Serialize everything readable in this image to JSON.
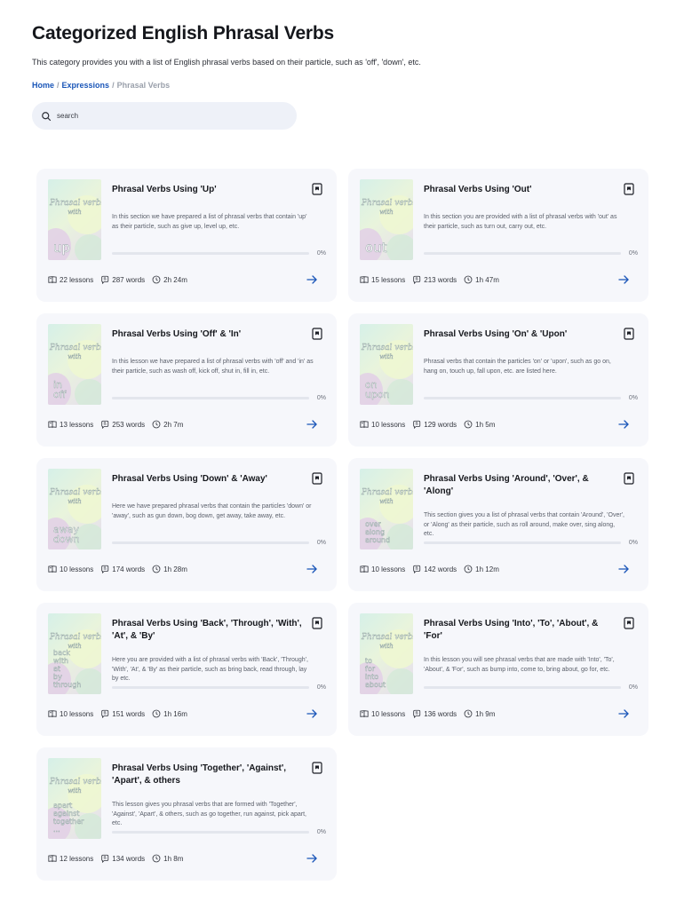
{
  "page": {
    "title": "Categorized English Phrasal Verbs",
    "description": "This category provides you with a list of English phrasal verbs based on their particle, such as 'off', 'down', etc."
  },
  "breadcrumb": {
    "home": "Home",
    "expressions": "Expressions",
    "current": "Phrasal Verbs"
  },
  "search": {
    "placeholder": "search",
    "value": ""
  },
  "colors": {
    "accent": "#1a56b8",
    "card_bg": "#f6f7fb",
    "search_bg": "#eef1f8"
  },
  "icons": {
    "search": "search-icon",
    "bookmark": "bookmark-icon",
    "lessons": "book-icon",
    "words": "words-icon",
    "duration": "clock-icon",
    "go": "arrow-right-icon"
  },
  "cover": {
    "line1": "Phrasal verbs",
    "line2": "with"
  },
  "cards": [
    {
      "title": "Phrasal Verbs Using 'Up'",
      "description": "In this section we have prepared a list of phrasal verbs that contain 'up' as their particle, such as give up, level up, etc.",
      "progress": 0,
      "progress_label": "0%",
      "lessons": "22 lessons",
      "words": "287 words",
      "duration": "2h 24m",
      "cover_text": "up"
    },
    {
      "title": "Phrasal Verbs Using 'Out'",
      "description": "In this section you are provided with a list of phrasal verbs with 'out' as their particle, such as turn out, carry out, etc.",
      "progress": 0,
      "progress_label": "0%",
      "lessons": "15 lessons",
      "words": "213 words",
      "duration": "1h 47m",
      "cover_text": "out"
    },
    {
      "title": "Phrasal Verbs Using 'Off' & 'In'",
      "description": "In this lesson we have prepared a list of phrasal verbs with 'off' and 'in' as their particle, such as wash off, kick off, shut in, fill in, etc.",
      "progress": 0,
      "progress_label": "0%",
      "lessons": "13 lessons",
      "words": "253 words",
      "duration": "2h 7m",
      "cover_text": "in off"
    },
    {
      "title": "Phrasal Verbs Using 'On' & 'Upon'",
      "description": "Phrasal verbs that contain the particles 'on' or 'upon', such as go on, hang on, touch up, fall upon, etc. are listed here.",
      "progress": 0,
      "progress_label": "0%",
      "lessons": "10 lessons",
      "words": "129 words",
      "duration": "1h 5m",
      "cover_text": "on upon"
    },
    {
      "title": "Phrasal Verbs Using 'Down' & 'Away'",
      "description": "Here we have prepared phrasal verbs that contain the particles 'down' or 'away', such as gun down, bog down, get away, take away, etc.",
      "progress": 0,
      "progress_label": "0%",
      "lessons": "10 lessons",
      "words": "174 words",
      "duration": "1h 28m",
      "cover_text": "away down"
    },
    {
      "title": "Phrasal Verbs Using 'Around', 'Over', & 'Along'",
      "description": "This section gives you a list of phrasal verbs that contain 'Around', 'Over', or 'Along' as their particle, such as roll around, make over, sing along, etc.",
      "progress": 0,
      "progress_label": "0%",
      "lessons": "10 lessons",
      "words": "142 words",
      "duration": "1h 12m",
      "cover_text": "over along around"
    },
    {
      "title": "Phrasal Verbs Using 'Back', 'Through', 'With', 'At', & 'By'",
      "description": "Here you are provided with a list of phrasal verbs with 'Back', 'Through', 'With', 'At', & 'By' as their particle, such as bring back, read through, lay by etc.",
      "progress": 0,
      "progress_label": "0%",
      "lessons": "10 lessons",
      "words": "151 words",
      "duration": "1h 16m",
      "cover_text": "back with at by through"
    },
    {
      "title": "Phrasal Verbs Using 'Into', 'To', 'About', & 'For'",
      "description": "In this lesson you will see phrasal verbs that are made with 'Into', 'To', 'About', & 'For', such as bump into, come to, bring about, go for, etc.",
      "progress": 0,
      "progress_label": "0%",
      "lessons": "10 lessons",
      "words": "136 words",
      "duration": "1h 9m",
      "cover_text": "to for into about"
    },
    {
      "title": "Phrasal Verbs Using 'Together', 'Against', 'Apart', & others",
      "description": "This lesson gives you phrasal verbs that are formed with 'Together', 'Against', 'Apart', & others, such as go together, run against, pick apart, etc.",
      "progress": 0,
      "progress_label": "0%",
      "lessons": "12 lessons",
      "words": "134 words",
      "duration": "1h 8m",
      "cover_text": "apart against together ..."
    }
  ]
}
